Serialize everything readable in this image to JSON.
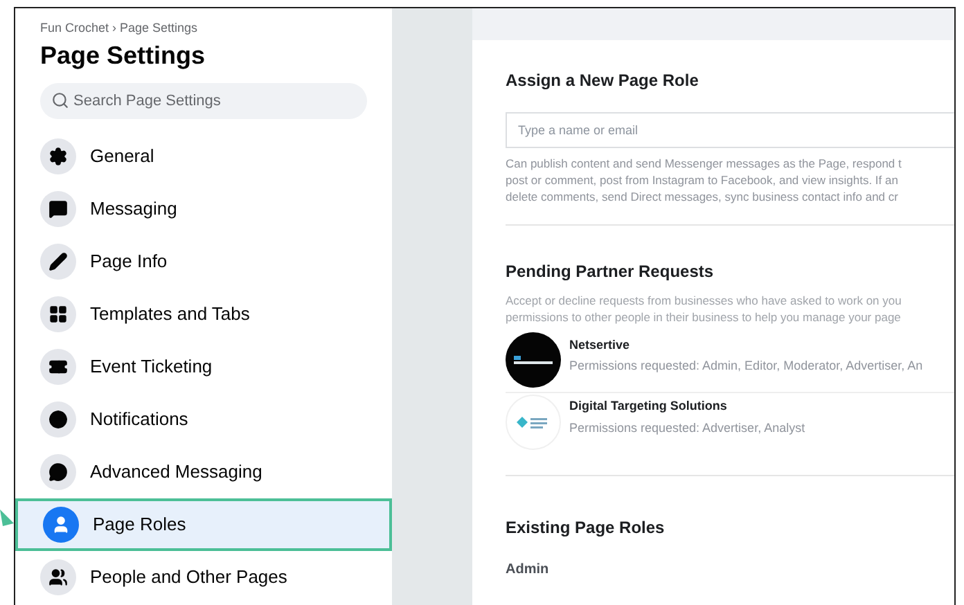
{
  "breadcrumb": "Fun Crochet › Page Settings",
  "title": "Page Settings",
  "search": {
    "placeholder": "Search Page Settings"
  },
  "nav": [
    {
      "label": "General",
      "selected": false
    },
    {
      "label": "Messaging",
      "selected": false
    },
    {
      "label": "Page Info",
      "selected": false
    },
    {
      "label": "Templates and Tabs",
      "selected": false
    },
    {
      "label": "Event Ticketing",
      "selected": false
    },
    {
      "label": "Notifications",
      "selected": false
    },
    {
      "label": "Advanced Messaging",
      "selected": false
    },
    {
      "label": "Page Roles",
      "selected": true
    },
    {
      "label": "People and Other Pages",
      "selected": false
    }
  ],
  "assign": {
    "heading": "Assign a New Page Role",
    "placeholder": "Type a name or email",
    "description": [
      "Can publish content and send Messenger messages as the Page, respond t",
      "post or comment, post from Instagram to Facebook, and view insights. If an",
      "delete comments, send Direct messages, sync business contact info and cr"
    ]
  },
  "pending": {
    "heading": "Pending Partner Requests",
    "description": [
      "Accept or decline requests from businesses who have asked to work on you",
      "permissions to other people in their business to help you manage your page"
    ],
    "requests": [
      {
        "name": "Netsertive",
        "permissions": "Permissions requested: Admin, Editor, Moderator, Advertiser, An"
      },
      {
        "name": "Digital Targeting Solutions",
        "permissions": "Permissions requested: Advertiser, Analyst"
      }
    ]
  },
  "existing": {
    "heading": "Existing Page Roles",
    "subheading": "Admin"
  }
}
